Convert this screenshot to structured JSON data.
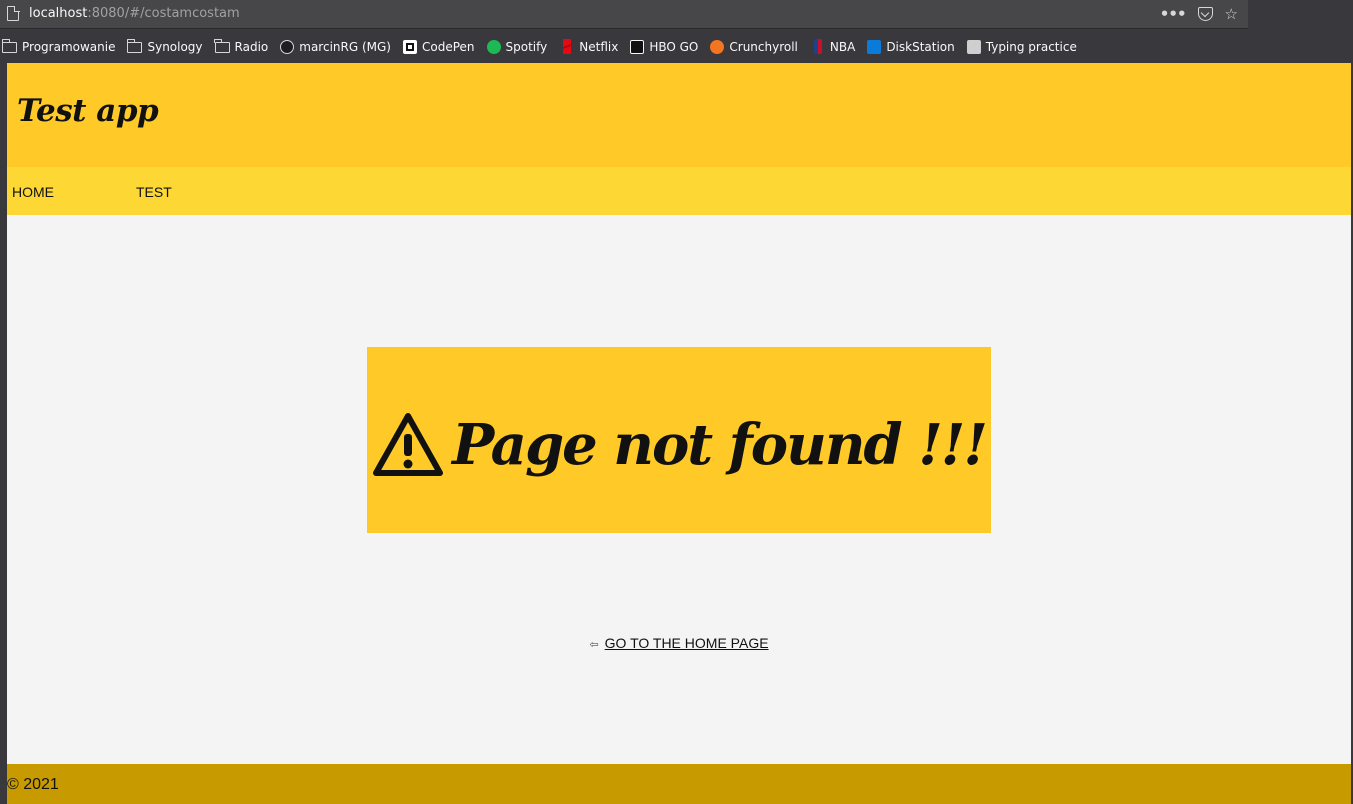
{
  "browser": {
    "url_host": "localhost",
    "url_rest": ":8080/#/costamcostam",
    "bookmarks": [
      {
        "label": "Programowanie",
        "icon": "folder-icon",
        "kind": "folder"
      },
      {
        "label": "Synology",
        "icon": "folder-icon",
        "kind": "folder"
      },
      {
        "label": "Radio",
        "icon": "folder-icon",
        "kind": "folder"
      },
      {
        "label": "marcinRG (MG)",
        "icon": "github-icon",
        "kind": "site",
        "color": "#1b1f23"
      },
      {
        "label": "CodePen",
        "icon": "codepen-icon",
        "kind": "site",
        "color": "#ffffff"
      },
      {
        "label": "Spotify",
        "icon": "spotify-icon",
        "kind": "site",
        "color": "#1db954"
      },
      {
        "label": "Netflix",
        "icon": "netflix-icon",
        "kind": "site",
        "color": "#e50914"
      },
      {
        "label": "HBO GO",
        "icon": "hbo-go-icon",
        "kind": "site",
        "color": "#f4f4f4"
      },
      {
        "label": "Crunchyroll",
        "icon": "crunchyroll-icon",
        "kind": "site",
        "color": "#f47521"
      },
      {
        "label": "NBA",
        "icon": "nba-icon",
        "kind": "site",
        "color": "#1d428a"
      },
      {
        "label": "DiskStation",
        "icon": "diskstation-icon",
        "kind": "site",
        "color": "#0a7bd8"
      },
      {
        "label": "Typing practice",
        "icon": "typing-icon",
        "kind": "site",
        "color": "#cfcfcf"
      }
    ]
  },
  "app": {
    "title": "Test app",
    "nav": {
      "home": "HOME",
      "test": "TEST"
    },
    "not_found": {
      "icon": "warning-icon",
      "message": "Page not found !!!"
    },
    "home_link": {
      "arrow": "⇦",
      "label": "GO TO THE HOME PAGE"
    },
    "footer": "© 2021",
    "colors": {
      "header": "#ffca28",
      "nav": "#fdd835",
      "footer": "#c79a00",
      "background": "#f4f4f4"
    }
  }
}
